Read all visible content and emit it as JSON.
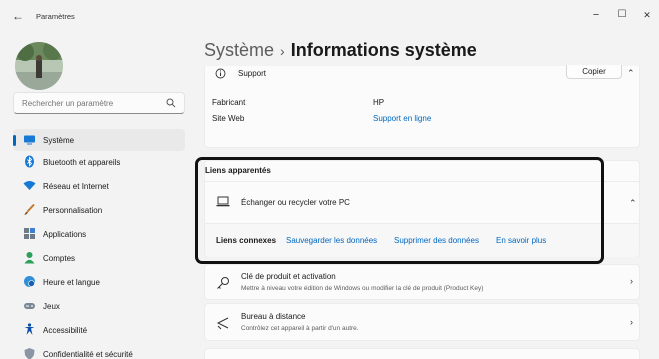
{
  "window": {
    "title": "Paramètres",
    "back_glyph": "←",
    "minimize_glyph": "−",
    "maximize_glyph": "☐",
    "close_glyph": "✕"
  },
  "search": {
    "placeholder": "Rechercher un paramètre",
    "icon": "search-icon"
  },
  "sidebar": {
    "items": [
      {
        "label": "Système",
        "icon": "system-icon",
        "active": true
      },
      {
        "label": "Bluetooth et appareils",
        "icon": "bluetooth-icon"
      },
      {
        "label": "Réseau et Internet",
        "icon": "wifi-icon"
      },
      {
        "label": "Personnalisation",
        "icon": "brush-icon"
      },
      {
        "label": "Applications",
        "icon": "apps-icon"
      },
      {
        "label": "Comptes",
        "icon": "account-icon"
      },
      {
        "label": "Heure et langue",
        "icon": "globe-clock-icon"
      },
      {
        "label": "Jeux",
        "icon": "gamepad-icon"
      },
      {
        "label": "Accessibilité",
        "icon": "accessibility-icon"
      },
      {
        "label": "Confidentialité et sécurité",
        "icon": "shield-icon"
      }
    ]
  },
  "header": {
    "crumb": "Système",
    "separator": "›",
    "current": "Informations système"
  },
  "support": {
    "label": "Support",
    "copy_label": "Copier",
    "manufacturer_label": "Fabricant",
    "manufacturer_value": "HP",
    "website_label": "Site Web",
    "website_value": "Support en ligne"
  },
  "related": {
    "heading": "Liens apparentés",
    "exchange_label": "Échanger ou recycler votre PC",
    "connexes_label": "Liens connexes",
    "links": [
      "Sauvegarder les données",
      "Supprimer des données",
      "En savoir plus"
    ]
  },
  "settings": [
    {
      "title": "Clé de produit et activation",
      "subtitle": "Mettre à niveau votre édition de Windows ou modifier la clé de produit (Product Key)",
      "icon": "key-icon"
    },
    {
      "title": "Bureau à distance",
      "subtitle": "Contrôlez cet appareil à partir d'un autre.",
      "icon": "remote-desktop-icon"
    }
  ],
  "colors": {
    "accent": "#0067c0",
    "background": "#f3f3f3",
    "card": "#fbfbfb",
    "highlight_border": "#111111"
  }
}
